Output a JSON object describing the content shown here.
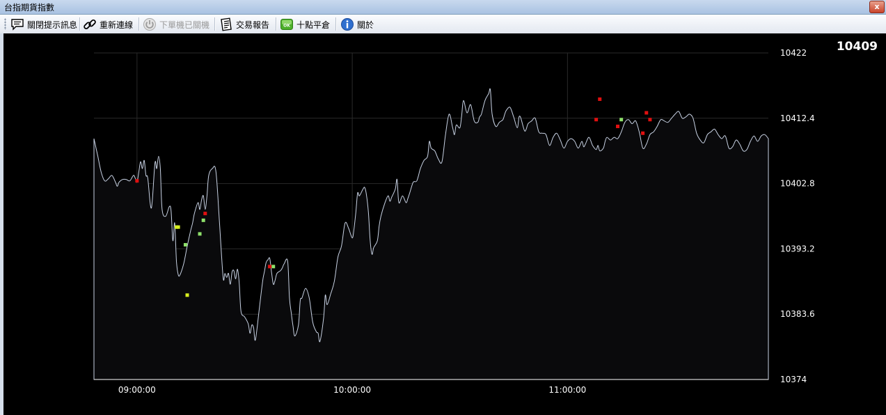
{
  "window": {
    "title": "台指期貨指數",
    "close_label": "x"
  },
  "toolbar": {
    "items": [
      {
        "label": "關閉提示訊息",
        "icon": "speech-bubble-icon",
        "enabled": true
      },
      {
        "label": "重新連線",
        "icon": "chain-link-icon",
        "enabled": true
      },
      {
        "label": "下單機已關機",
        "icon": "power-icon",
        "enabled": false
      },
      {
        "label": "交易報告",
        "icon": "report-icon",
        "enabled": true
      },
      {
        "label": "十點平倉",
        "icon": "ok-icon",
        "enabled": true
      },
      {
        "label": "關於",
        "icon": "info-icon",
        "enabled": true
      }
    ]
  },
  "current_price": "10409",
  "chart_data": {
    "type": "area",
    "ylim": [
      10374,
      10422
    ],
    "y_ticks": [
      "10422",
      "10412.4",
      "10402.8",
      "10393.2",
      "10383.6",
      "10374"
    ],
    "x_ticks": [
      "09:00:00",
      "10:00:00",
      "11:00:00"
    ],
    "x_tick_minutes": [
      20,
      80,
      140
    ],
    "x_range_minutes": [
      8,
      196
    ],
    "grid": true,
    "series": [
      {
        "values": [
          [
            8,
            10409.4
          ],
          [
            9,
            10407
          ],
          [
            10,
            10404.5
          ],
          [
            11,
            10403.2
          ],
          [
            12,
            10403.5
          ],
          [
            13,
            10404
          ],
          [
            14,
            10403
          ],
          [
            14.5,
            10402.4
          ],
          [
            15,
            10403
          ],
          [
            16,
            10403.4
          ],
          [
            17,
            10403.4
          ],
          [
            18,
            10403.2
          ],
          [
            19,
            10404
          ],
          [
            19.5,
            10403.6
          ],
          [
            20,
            10403
          ],
          [
            20.5,
            10404.5
          ],
          [
            21,
            10406
          ],
          [
            21.5,
            10405
          ],
          [
            22,
            10406.2
          ],
          [
            22.5,
            10404
          ],
          [
            23,
            10403.6
          ],
          [
            24,
            10399.2
          ],
          [
            25,
            10405.8
          ],
          [
            25.5,
            10405
          ],
          [
            26,
            10406.8
          ],
          [
            26.5,
            10405
          ],
          [
            27,
            10399
          ],
          [
            28,
            10398
          ],
          [
            29,
            10399.4
          ],
          [
            29.5,
            10398.8
          ],
          [
            30,
            10394.4
          ],
          [
            30.5,
            10397
          ],
          [
            31,
            10391.4
          ],
          [
            31.5,
            10389.4
          ],
          [
            32,
            10389.4
          ],
          [
            33,
            10391
          ],
          [
            34,
            10393.6
          ],
          [
            35,
            10396
          ],
          [
            35.5,
            10397
          ],
          [
            36,
            10398.4
          ],
          [
            37,
            10400
          ],
          [
            37.5,
            10399
          ],
          [
            38,
            10400.4
          ],
          [
            38.5,
            10401
          ],
          [
            39,
            10399
          ],
          [
            39.5,
            10401
          ],
          [
            40,
            10404
          ],
          [
            41,
            10405
          ],
          [
            42,
            10404.6
          ],
          [
            43,
            10397
          ],
          [
            44,
            10389
          ],
          [
            44.5,
            10389.6
          ],
          [
            45,
            10389
          ],
          [
            45.5,
            10389.6
          ],
          [
            46,
            10388
          ],
          [
            46.5,
            10389.8
          ],
          [
            47,
            10390
          ],
          [
            47.5,
            10388.8
          ],
          [
            48,
            10390.2
          ],
          [
            48.5,
            10388.2
          ],
          [
            49,
            10384
          ],
          [
            50,
            10383.2
          ],
          [
            51,
            10382.2
          ],
          [
            51.5,
            10380.8
          ],
          [
            52,
            10382
          ],
          [
            52.5,
            10381.6
          ],
          [
            53,
            10379.8
          ],
          [
            54,
            10384
          ],
          [
            55,
            10388.4
          ],
          [
            55.5,
            10389.8
          ],
          [
            56,
            10391.2
          ],
          [
            56.5,
            10391.6
          ],
          [
            57,
            10391.8
          ],
          [
            57.5,
            10389.8
          ],
          [
            58,
            10388
          ],
          [
            58.5,
            10388.6
          ],
          [
            59,
            10389.6
          ],
          [
            60,
            10390
          ],
          [
            60.5,
            10390.4
          ],
          [
            61,
            10391
          ],
          [
            62,
            10391.4
          ],
          [
            62.5,
            10386
          ],
          [
            63,
            10383.8
          ],
          [
            63.5,
            10381.8
          ],
          [
            64,
            10380.4
          ],
          [
            65,
            10382
          ],
          [
            65.5,
            10385.6
          ],
          [
            66,
            10386
          ],
          [
            67,
            10387.4
          ],
          [
            68,
            10386
          ],
          [
            69,
            10382.4
          ],
          [
            70,
            10381
          ],
          [
            70.5,
            10380.8
          ],
          [
            71,
            10379.6
          ],
          [
            72,
            10383
          ],
          [
            72.5,
            10386.4
          ],
          [
            73,
            10385
          ],
          [
            74,
            10386.6
          ],
          [
            75,
            10388.4
          ],
          [
            76,
            10392
          ],
          [
            77,
            10393.6
          ],
          [
            78,
            10397
          ],
          [
            79,
            10396.2
          ],
          [
            80,
            10394.8
          ],
          [
            80.5,
            10396.2
          ],
          [
            81,
            10398.6
          ],
          [
            81.5,
            10401.4
          ],
          [
            82,
            10401
          ],
          [
            83,
            10402
          ],
          [
            83.5,
            10402.2
          ],
          [
            84,
            10401
          ],
          [
            84.5,
            10398.6
          ],
          [
            85,
            10394.4
          ],
          [
            85.5,
            10392.4
          ],
          [
            86,
            10393.4
          ],
          [
            87,
            10394.4
          ],
          [
            87.5,
            10396.6
          ],
          [
            88,
            10398
          ],
          [
            89,
            10399.8
          ],
          [
            90,
            10401
          ],
          [
            90.5,
            10400.2
          ],
          [
            91,
            10400.8
          ],
          [
            92,
            10402
          ],
          [
            92.5,
            10403.4
          ],
          [
            93,
            10400
          ],
          [
            94,
            10401
          ],
          [
            95,
            10400
          ],
          [
            95.5,
            10400.6
          ],
          [
            96,
            10401.4
          ],
          [
            97,
            10403
          ],
          [
            98,
            10403.2
          ],
          [
            99,
            10405
          ],
          [
            100,
            10406.2
          ],
          [
            101,
            10406.8
          ],
          [
            101.5,
            10409
          ],
          [
            102,
            10408
          ],
          [
            103,
            10407.6
          ],
          [
            104,
            10406.4
          ],
          [
            105,
            10406
          ],
          [
            106,
            10410
          ],
          [
            107,
            10413
          ],
          [
            108,
            10411
          ],
          [
            108.5,
            10410
          ],
          [
            109,
            10411.4
          ],
          [
            110,
            10411
          ],
          [
            110.5,
            10412.8
          ],
          [
            111,
            10415
          ],
          [
            112,
            10413.2
          ],
          [
            113,
            10414.4
          ],
          [
            114,
            10412
          ],
          [
            115,
            10411.8
          ],
          [
            115.5,
            10412.6
          ],
          [
            116,
            10413
          ],
          [
            117,
            10415
          ],
          [
            118,
            10416
          ],
          [
            118.5,
            10416.6
          ],
          [
            119,
            10413
          ],
          [
            120,
            10411.2
          ],
          [
            121,
            10411.8
          ],
          [
            122,
            10412.2
          ],
          [
            122.5,
            10413
          ],
          [
            123,
            10413.6
          ],
          [
            124,
            10414
          ],
          [
            125,
            10412.6
          ],
          [
            126,
            10411
          ],
          [
            126.5,
            10412.6
          ],
          [
            127,
            10412.4
          ],
          [
            128,
            10410.6
          ],
          [
            128.5,
            10410.8
          ],
          [
            129,
            10411.6
          ],
          [
            130,
            10412
          ],
          [
            131,
            10412.4
          ],
          [
            132,
            10410.4
          ],
          [
            133,
            10410.2
          ],
          [
            134,
            10410
          ],
          [
            135,
            10408.4
          ],
          [
            136,
            10409.6
          ],
          [
            137,
            10410.2
          ],
          [
            138,
            10409.2
          ],
          [
            139,
            10408
          ],
          [
            140,
            10409
          ],
          [
            141,
            10409.4
          ],
          [
            142,
            10409
          ],
          [
            143,
            10408
          ],
          [
            144,
            10409
          ],
          [
            144.5,
            10408.2
          ],
          [
            145,
            10408.6
          ],
          [
            146,
            10409.6
          ],
          [
            147,
            10408.4
          ],
          [
            148,
            10407.8
          ],
          [
            148.5,
            10408.4
          ],
          [
            149,
            10407.6
          ],
          [
            150,
            10408
          ],
          [
            150.5,
            10409
          ],
          [
            151,
            10409.6
          ],
          [
            152,
            10409.2
          ],
          [
            153,
            10409.6
          ],
          [
            154,
            10409.4
          ],
          [
            155,
            10410.4
          ],
          [
            156,
            10411.8
          ],
          [
            157,
            10412.2
          ],
          [
            158,
            10411.6
          ],
          [
            159,
            10412
          ],
          [
            160,
            10410.4
          ],
          [
            161,
            10408
          ],
          [
            162,
            10408.6
          ],
          [
            163,
            10410
          ],
          [
            164,
            10410.4
          ],
          [
            165,
            10411.2
          ],
          [
            166,
            10412.2
          ],
          [
            167,
            10412
          ],
          [
            168,
            10411.8
          ],
          [
            169,
            10412.4
          ],
          [
            170,
            10413
          ],
          [
            171,
            10413.4
          ],
          [
            172,
            10412.4
          ],
          [
            173,
            10412.6
          ],
          [
            174,
            10413
          ],
          [
            175,
            10412.4
          ],
          [
            176,
            10410.2
          ],
          [
            177,
            10409.2
          ],
          [
            178,
            10408.8
          ],
          [
            179,
            10410
          ],
          [
            180,
            10410.4
          ],
          [
            181,
            10410.8
          ],
          [
            182,
            10410
          ],
          [
            183,
            10409.4
          ],
          [
            184,
            10409.8
          ],
          [
            185,
            10408
          ],
          [
            186,
            10408.2
          ],
          [
            187,
            10409.2
          ],
          [
            188,
            10408.6
          ],
          [
            189,
            10407.6
          ],
          [
            190,
            10407.8
          ],
          [
            191,
            10409
          ],
          [
            192,
            10409.8
          ],
          [
            193,
            10409
          ],
          [
            194,
            10409.8
          ],
          [
            195,
            10410
          ],
          [
            196,
            10409.4
          ]
        ]
      }
    ],
    "markers": [
      {
        "x": 20,
        "y": 10403.2,
        "color": "#e01010"
      },
      {
        "x": 31,
        "y": 10396.4,
        "color": "#d8f020"
      },
      {
        "x": 31.5,
        "y": 10396.4,
        "color": "#d8f020"
      },
      {
        "x": 33.5,
        "y": 10393.8,
        "color": "#8ee06a"
      },
      {
        "x": 34,
        "y": 10386.4,
        "color": "#d8f020"
      },
      {
        "x": 37.5,
        "y": 10395.4,
        "color": "#8ee06a"
      },
      {
        "x": 38.5,
        "y": 10397.4,
        "color": "#8ee06a"
      },
      {
        "x": 39,
        "y": 10398.4,
        "color": "#e01010"
      },
      {
        "x": 57,
        "y": 10390.6,
        "color": "#e01010"
      },
      {
        "x": 58,
        "y": 10390.6,
        "color": "#8ee06a"
      },
      {
        "x": 148,
        "y": 10412.2,
        "color": "#e01010"
      },
      {
        "x": 149,
        "y": 10415.2,
        "color": "#e01010"
      },
      {
        "x": 154,
        "y": 10411.2,
        "color": "#e01010"
      },
      {
        "x": 155,
        "y": 10412.2,
        "color": "#8ee06a"
      },
      {
        "x": 161,
        "y": 10410.2,
        "color": "#e01010"
      },
      {
        "x": 162,
        "y": 10413.2,
        "color": "#e01010"
      },
      {
        "x": 163,
        "y": 10412.2,
        "color": "#e01010"
      }
    ]
  }
}
